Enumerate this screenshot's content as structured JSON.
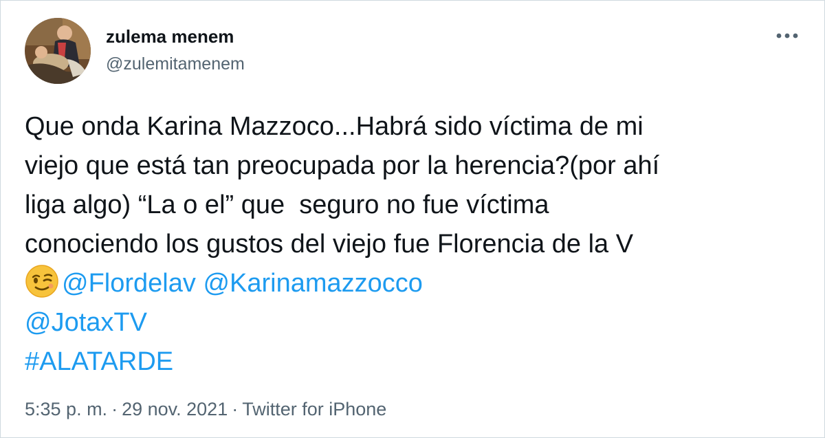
{
  "author": {
    "display_name": "zulema menem",
    "handle": "@zulemitamenem"
  },
  "tweet": {
    "lines": [
      "Que onda Karina Mazzoco...Habrá sido víctima de mi",
      "viejo que está tan preocupada por la herencia?(por ahí",
      "liga algo) “La o el” que  seguro no fue víctima",
      "conociendo los gustos del viejo fue Florencia de la V"
    ],
    "emoji": "😉",
    "mentions": [
      "@Flordelav",
      "@Karinamazzocco",
      "@JotaxTV"
    ],
    "hashtag": "#ALATARDE"
  },
  "meta": {
    "time": "5:35 p. m.",
    "date": "29 nov. 2021",
    "source": "Twitter for iPhone",
    "separator": "·"
  },
  "colors": {
    "link": "#1d9bf0",
    "secondary_text": "#536471",
    "primary_text": "#0f1419",
    "border": "#cfd9de"
  },
  "icons": {
    "more": "more-horizontal-icon",
    "emoji": "winking-face-emoji"
  }
}
